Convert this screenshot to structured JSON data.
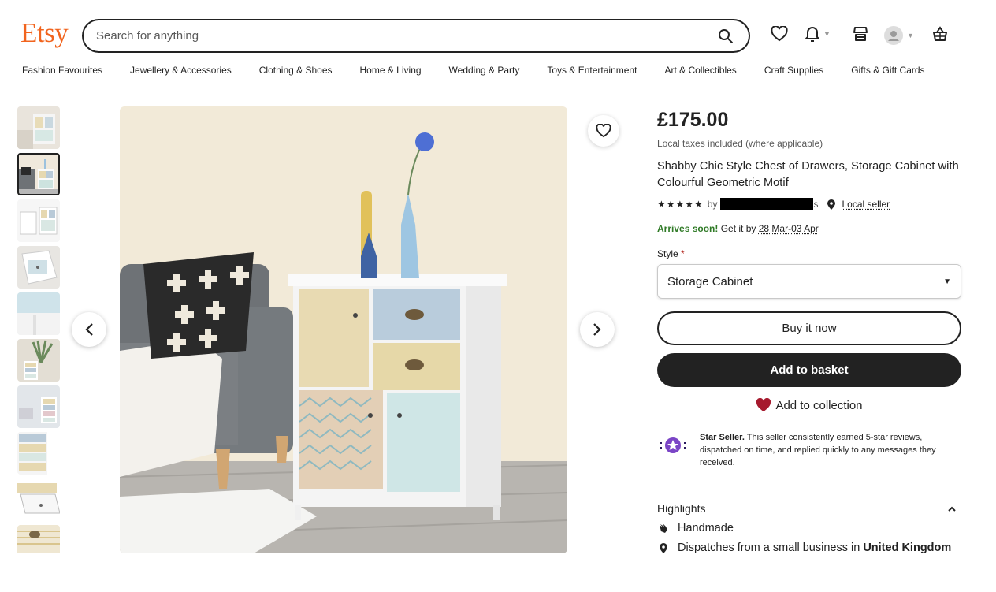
{
  "header": {
    "logo": "Etsy",
    "search_placeholder": "Search for anything"
  },
  "nav": [
    "Fashion Favourites",
    "Jewellery & Accessories",
    "Clothing & Shoes",
    "Home & Living",
    "Wedding & Party",
    "Toys & Entertainment",
    "Art & Collectibles",
    "Craft Supplies",
    "Gifts & Gift Cards"
  ],
  "product": {
    "price": "£175.00",
    "taxes": "Local taxes included (where applicable)",
    "title": "Shabby Chic Style Chest of Drawers, Storage Cabinet with Colourful Geometric Motif",
    "rating_stars": "★★★★★",
    "by_label": "by",
    "shop_name_tail": "s",
    "local_seller": "Local seller",
    "arrives_soon": "Arrives soon!",
    "get_it_by": "Get it by",
    "delivery_range": "28 Mar-03 Apr",
    "style_label": "Style",
    "style_required": "*",
    "style_value": "Storage Cabinet",
    "buy_now": "Buy it now",
    "add_to_basket": "Add to basket",
    "add_to_collection": "Add to collection"
  },
  "star_seller": {
    "title": "Star Seller.",
    "text": "This seller consistently earned 5-star reviews, dispatched on time, and replied quickly to any messages they received."
  },
  "highlights": {
    "title": "Highlights",
    "handmade": "Handmade",
    "dispatches_prefix": "Dispatches from a small business in",
    "dispatches_country": "United Kingdom"
  },
  "colors": {
    "brand": "#f1641e",
    "dark": "#222222",
    "collection_heart": "#a61a2e",
    "star_seller": "#7b45c6",
    "arrives_green": "#2f7a26"
  }
}
